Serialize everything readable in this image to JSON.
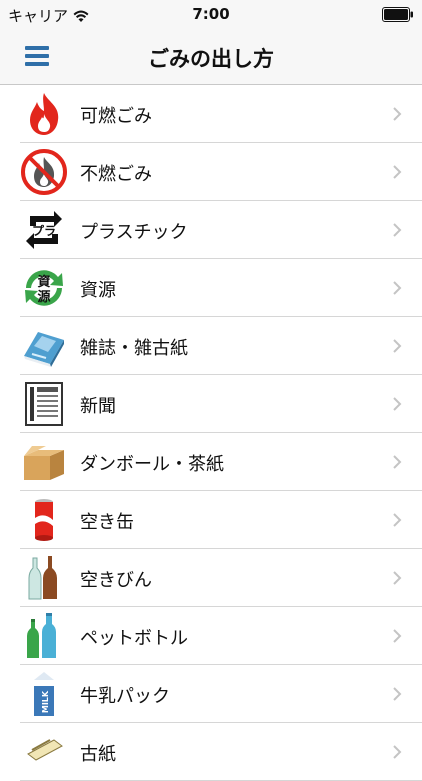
{
  "status": {
    "carrier": "キャリア",
    "time": "7:00"
  },
  "nav": {
    "title": "ごみの出し方"
  },
  "items": [
    {
      "label": "可燃ごみ",
      "icon": "flame-icon"
    },
    {
      "label": "不燃ごみ",
      "icon": "no-burn-icon"
    },
    {
      "label": "プラスチック",
      "icon": "plastic-recycle-icon"
    },
    {
      "label": "資源",
      "icon": "resources-recycle-icon"
    },
    {
      "label": "雑誌・雑古紙",
      "icon": "magazine-icon"
    },
    {
      "label": "新聞",
      "icon": "newspaper-icon"
    },
    {
      "label": "ダンボール・茶紙",
      "icon": "cardboard-box-icon"
    },
    {
      "label": "空き缶",
      "icon": "can-icon"
    },
    {
      "label": "空きびん",
      "icon": "bottle-icon"
    },
    {
      "label": "ペットボトル",
      "icon": "pet-bottle-icon"
    },
    {
      "label": "牛乳パック",
      "icon": "milk-carton-icon"
    },
    {
      "label": "古紙",
      "icon": "paper-icon"
    }
  ],
  "icon_text": {
    "plastic": "プラ",
    "resources_top": "資",
    "resources_bottom": "源",
    "milk": "MILK"
  },
  "colors": {
    "accent": "#2f6fa8",
    "flame": "#e2261c",
    "recycle_green": "#3aa54a"
  }
}
